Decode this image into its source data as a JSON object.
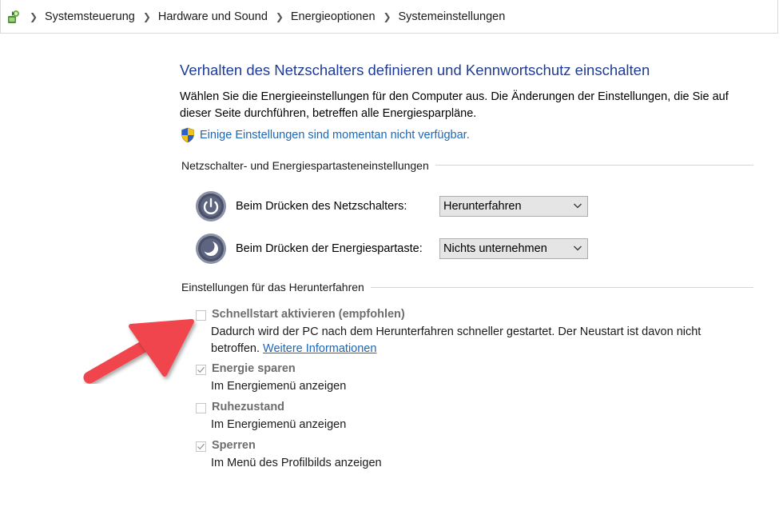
{
  "breadcrumb": {
    "items": [
      "Systemsteuerung",
      "Hardware und Sound",
      "Energieoptionen",
      "Systemeinstellungen"
    ]
  },
  "title": "Verhalten des Netzschalters definieren und Kennwortschutz einschalten",
  "description": "Wählen Sie die Energieeinstellungen für den Computer aus. Die Änderungen der Einstellungen, die Sie auf dieser Seite durchführen, betreffen alle Energiesparpläne.",
  "notice": {
    "icon": "uac-shield-icon",
    "text": "Einige Einstellungen sind momentan nicht verfügbar."
  },
  "power_section": {
    "title": "Netzschalter- und Energiespartasteneinstellungen",
    "rows": [
      {
        "icon": "power-button-icon",
        "label": "Beim Drücken des Netzschalters:",
        "value": "Herunterfahren"
      },
      {
        "icon": "sleep-button-icon",
        "label": "Beim Drücken der Energiespartaste:",
        "value": "Nichts unternehmen"
      }
    ]
  },
  "shutdown_section": {
    "title": "Einstellungen für das Herunterfahren",
    "options": [
      {
        "title": "Schnellstart aktivieren (empfohlen)",
        "checked": false,
        "desc": "Dadurch wird der PC nach dem Herunterfahren schneller gestartet. Der Neustart ist davon nicht betroffen.",
        "link": "Weitere Informationen"
      },
      {
        "title": "Energie sparen",
        "checked": true,
        "desc": "Im Energiemenü anzeigen"
      },
      {
        "title": "Ruhezustand",
        "checked": false,
        "desc": "Im Energiemenü anzeigen"
      },
      {
        "title": "Sperren",
        "checked": true,
        "desc": "Im Menü des Profilbilds anzeigen"
      }
    ]
  },
  "colors": {
    "title": "#1e3c96",
    "link": "#1c67b8",
    "arrow": "#f0444d",
    "disabled_text": "#6d6d6d"
  }
}
